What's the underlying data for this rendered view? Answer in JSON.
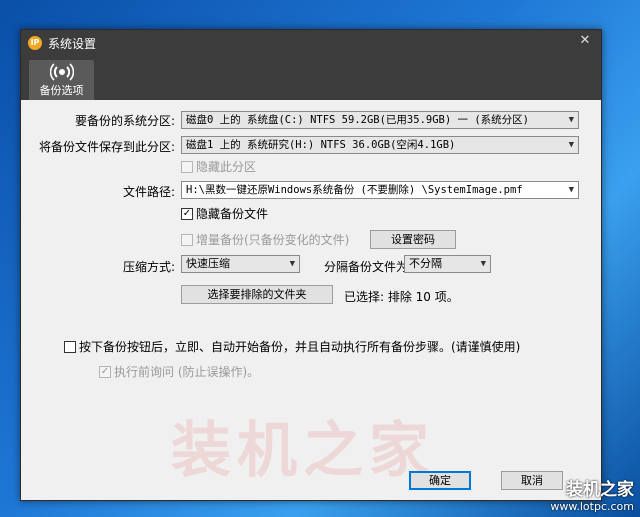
{
  "window": {
    "title": "系统设置",
    "app_icon": "IP"
  },
  "tab": {
    "label": "备份选项"
  },
  "form": {
    "source_label": "要备份的系统分区:",
    "source_value": "磁盘0 上的 系统盘(C:) NTFS 59.2GB(已用35.9GB) 一 (系统分区)",
    "dest_label": "将备份文件保存到此分区:",
    "dest_value": "磁盘1 上的 系统研究(H:) NTFS 36.0GB(空闲4.1GB)",
    "hide_partition_label": "隐藏此分区",
    "path_label": "文件路径:",
    "path_value": "H:\\黑数一键还原Windows系统备份 (不要删除) \\SystemImage.pmf",
    "hide_file_label": "隐藏备份文件",
    "incremental_label": "增量备份(只备份变化的文件)",
    "set_password_label": "设置密码",
    "compress_label": "压缩方式:",
    "compress_value": "快速压缩",
    "split_label": "分隔备份文件为:",
    "split_value": "不分隔",
    "exclude_button_label": "选择要排除的文件夹",
    "exclude_status": "已选择: 排除 10 项。",
    "auto_start_label": "按下备份按钮后，立即、自动开始备份，并且自动执行所有备份步骤。(请谨慎使用)",
    "ask_before_label": "执行前询问 (防止误操作)。"
  },
  "buttons": {
    "ok": "确定",
    "cancel": "取消"
  },
  "watermark": {
    "text": "装机之家",
    "logo": "装机之家",
    "url": "www.lotpc.com"
  },
  "state": {
    "hide_file_checked": true,
    "ask_before_checked": true
  }
}
